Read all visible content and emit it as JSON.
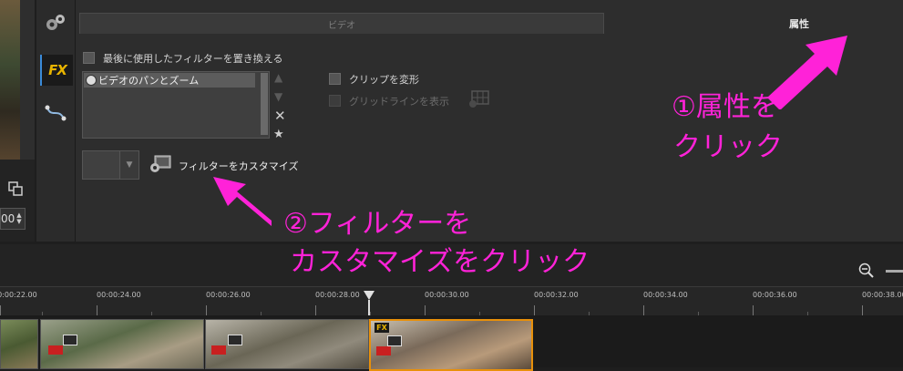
{
  "tabs": {
    "video": "ビデオ",
    "attributes": "属性"
  },
  "options": {
    "replace_last_filter": "最後に使用したフィルターを置き換える",
    "transform_clip": "クリップを変形",
    "show_gridlines": "グリッドラインを表示"
  },
  "filter_list": {
    "items": [
      "ビデオのパンとズーム"
    ]
  },
  "buttons": {
    "customize_filter": "フィルターをカスタマイズ"
  },
  "left_panel": {
    "counter": "00"
  },
  "timeline": {
    "ticks": [
      "00:00:22.00",
      "00:00:24.00",
      "00:00:26.00",
      "00:00:28.00",
      "00:00:30.00",
      "00:00:32.00",
      "00:00:34.00",
      "00:00:36.00",
      "00:00:38.00"
    ]
  },
  "annotations": {
    "step1_line1": "①属性を",
    "step1_line2": "クリック",
    "step2_line1": "②フィルターを",
    "step2_line2": "カスタマイズをクリック"
  },
  "colors": {
    "annotation": "#ff22d8",
    "clip_selected": "#e8900a",
    "fx_badge": "#e8b400"
  }
}
